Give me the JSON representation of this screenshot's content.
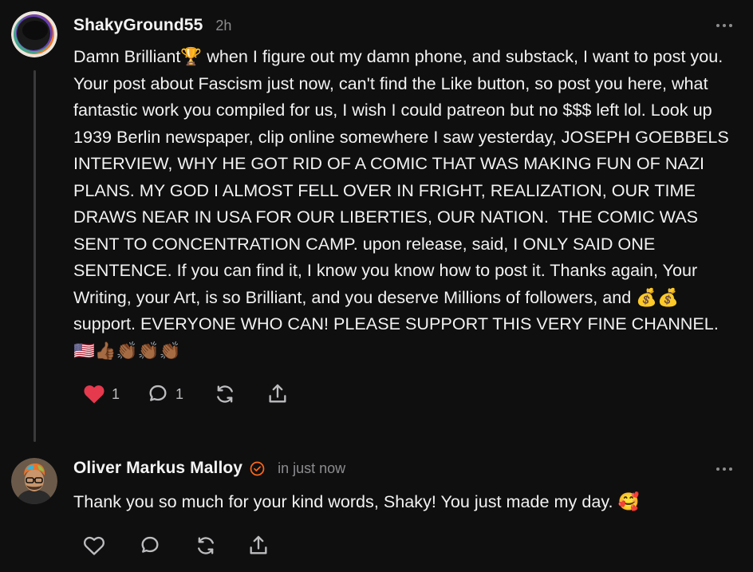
{
  "comments": [
    {
      "author": "ShakyGround55",
      "time": "2h",
      "text": "Damn Brilliant🏆 when I figure out my damn phone, and substack, I want to post you. Your post about Fascism just now, can't find the Like button, so post you here, what  fantastic work you compiled for us, I wish I could patreon but no $$$ left lol. Look up 1939 Berlin newspaper, clip online somewhere I saw yesterday, JOSEPH GOEBBELS INTERVIEW, WHY HE GOT RID OF A COMIC THAT WAS MAKING FUN OF NAZI PLANS. MY GOD I ALMOST FELL OVER IN FRIGHT, REALIZATION, OUR TIME DRAWS NEAR IN USA FOR OUR LIBERTIES, OUR NATION.  THE COMIC WAS SENT TO CONCENTRATION CAMP. upon release, said, I ONLY SAID ONE SENTENCE. If you can find it, I know you know how to post it. Thanks again, Your Writing, your Art, is so Brilliant, and you deserve Millions of followers, and 💰💰 support. EVERYONE WHO CAN! PLEASE SUPPORT THIS VERY FINE CHANNEL.🇺🇸👍🏾👏🏾👏🏾👏🏾",
      "like_count": "1",
      "reply_count": "1",
      "liked": true,
      "icons": {
        "avatar": "ring-avatar",
        "like": "heart-icon",
        "reply": "comment-bubble-icon",
        "restack": "restack-icon",
        "share": "share-icon",
        "more": "more-icon"
      }
    },
    {
      "author": "Oliver Markus Malloy",
      "time": "in just now",
      "text": "Thank you so much for your kind words, Shaky! You just made my day. 🥰",
      "liked": false,
      "icons": {
        "avatar": "portrait-avatar",
        "verified": "verified-check-icon",
        "like": "heart-icon",
        "reply": "comment-bubble-icon",
        "restack": "restack-icon",
        "share": "share-icon",
        "more": "more-icon"
      }
    }
  ],
  "colors": {
    "background": "#0f0f10",
    "text": "#f2f2f2",
    "muted": "#8d8d90",
    "like_active": "#e5394d",
    "accent": "#ff6719",
    "thread_line": "#3a3a3c"
  }
}
